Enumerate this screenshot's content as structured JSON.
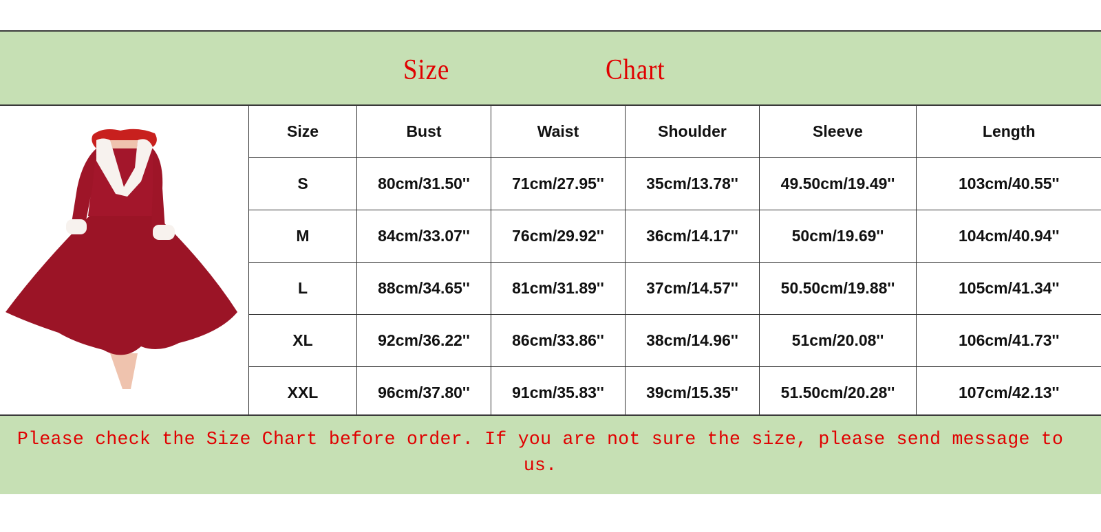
{
  "title": {
    "word1": "Size",
    "word2": "Chart"
  },
  "image": {
    "alt": "Red fur-trimmed swing dress"
  },
  "table": {
    "headers": [
      "Size",
      "Bust",
      "Waist",
      "Shoulder",
      "Sleeve",
      "Length"
    ],
    "rows": [
      [
        "S",
        "80cm/31.50''",
        "71cm/27.95''",
        "35cm/13.78''",
        "49.50cm/19.49''",
        "103cm/40.55''"
      ],
      [
        "M",
        "84cm/33.07''",
        "76cm/29.92''",
        "36cm/14.17''",
        "50cm/19.69''",
        "104cm/40.94''"
      ],
      [
        "L",
        "88cm/34.65''",
        "81cm/31.89''",
        "37cm/14.57''",
        "50.50cm/19.88''",
        "105cm/41.34''"
      ],
      [
        "XL",
        "92cm/36.22''",
        "86cm/33.86''",
        "38cm/14.96''",
        "51cm/20.08''",
        "106cm/41.73''"
      ],
      [
        "XXL",
        "96cm/37.80''",
        "91cm/35.83''",
        "39cm/15.35''",
        "51.50cm/20.28''",
        "107cm/42.13''"
      ]
    ]
  },
  "note": "Please check the Size Chart before order. If you are not sure the size, please send message to us.",
  "colors": {
    "band": "#c6e0b4",
    "accent_text": "#e00000",
    "dress": "#9b1426"
  }
}
